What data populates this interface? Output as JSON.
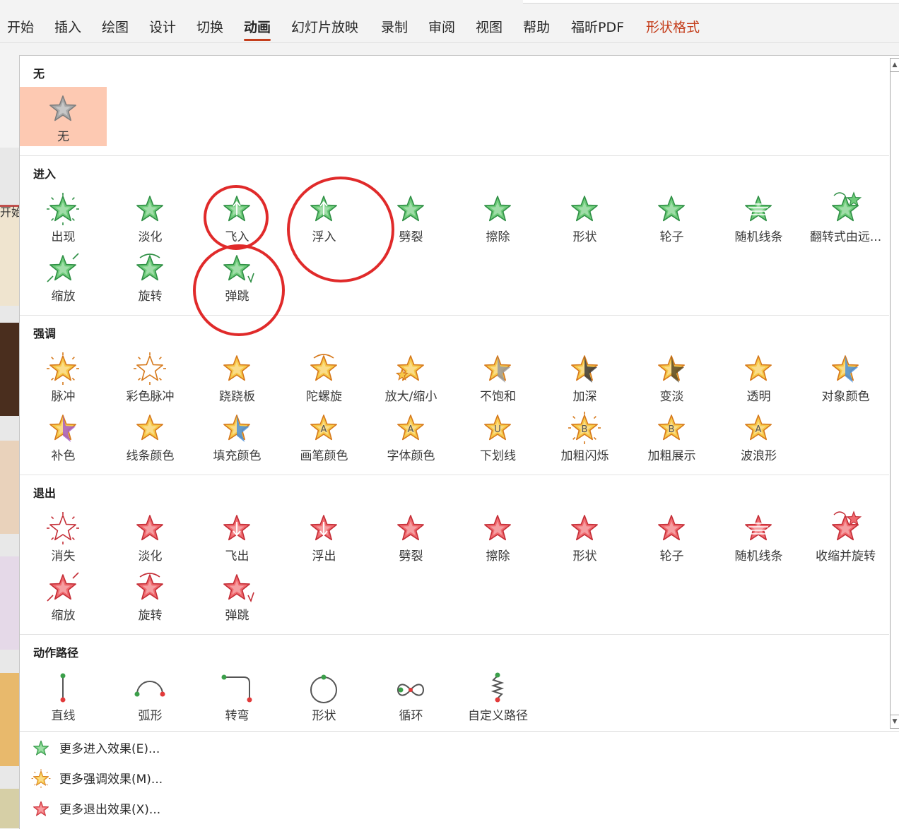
{
  "ribbon": {
    "tabs": [
      {
        "label": "开始",
        "state": "normal"
      },
      {
        "label": "插入",
        "state": "normal"
      },
      {
        "label": "绘图",
        "state": "normal"
      },
      {
        "label": "设计",
        "state": "normal"
      },
      {
        "label": "切换",
        "state": "normal"
      },
      {
        "label": "动画",
        "state": "active"
      },
      {
        "label": "幻灯片放映",
        "state": "normal"
      },
      {
        "label": "录制",
        "state": "normal"
      },
      {
        "label": "审阅",
        "state": "normal"
      },
      {
        "label": "视图",
        "state": "normal"
      },
      {
        "label": "帮助",
        "state": "normal"
      },
      {
        "label": "福昕PDF",
        "state": "normal"
      },
      {
        "label": "形状格式",
        "state": "contextual"
      }
    ]
  },
  "left_strip": {
    "partial_label": "开始"
  },
  "gallery": {
    "sections": [
      {
        "title": "无",
        "items": [
          {
            "label": "无",
            "icon": "none-star-icon",
            "kind": "none",
            "selected": true
          }
        ]
      },
      {
        "title": "进入",
        "items": [
          {
            "label": "出现",
            "icon": "appear-star-icon",
            "kind": "entrance"
          },
          {
            "label": "淡化",
            "icon": "fade-star-icon",
            "kind": "entrance"
          },
          {
            "label": "飞入",
            "icon": "fly-in-star-icon",
            "kind": "entrance",
            "highlight": true
          },
          {
            "label": "浮入",
            "icon": "float-in-star-icon",
            "kind": "entrance",
            "highlight": true
          },
          {
            "label": "劈裂",
            "icon": "split-star-icon",
            "kind": "entrance"
          },
          {
            "label": "擦除",
            "icon": "wipe-star-icon",
            "kind": "entrance"
          },
          {
            "label": "形状",
            "icon": "shape-star-icon",
            "kind": "entrance"
          },
          {
            "label": "轮子",
            "icon": "wheel-star-icon",
            "kind": "entrance"
          },
          {
            "label": "随机线条",
            "icon": "random-bars-star-icon",
            "kind": "entrance"
          },
          {
            "label": "翻转式由远...",
            "icon": "grow-turn-star-icon",
            "kind": "entrance"
          },
          {
            "label": "缩放",
            "icon": "zoom-star-icon",
            "kind": "entrance"
          },
          {
            "label": "旋转",
            "icon": "swivel-star-icon",
            "kind": "entrance"
          },
          {
            "label": "弹跳",
            "icon": "bounce-star-icon",
            "kind": "entrance",
            "highlight": true
          }
        ]
      },
      {
        "title": "强调",
        "items": [
          {
            "label": "脉冲",
            "icon": "pulse-star-icon",
            "kind": "emphasis"
          },
          {
            "label": "彩色脉冲",
            "icon": "color-pulse-star-icon",
            "kind": "emphasis"
          },
          {
            "label": "跷跷板",
            "icon": "teeter-star-icon",
            "kind": "emphasis"
          },
          {
            "label": "陀螺旋",
            "icon": "spin-star-icon",
            "kind": "emphasis"
          },
          {
            "label": "放大/缩小",
            "icon": "grow-shrink-star-icon",
            "kind": "emphasis"
          },
          {
            "label": "不饱和",
            "icon": "desaturate-star-icon",
            "kind": "emphasis"
          },
          {
            "label": "加深",
            "icon": "darken-star-icon",
            "kind": "emphasis"
          },
          {
            "label": "变淡",
            "icon": "lighten-star-icon",
            "kind": "emphasis"
          },
          {
            "label": "透明",
            "icon": "transparency-star-icon",
            "kind": "emphasis"
          },
          {
            "label": "对象颜色",
            "icon": "object-color-star-icon",
            "kind": "emphasis"
          },
          {
            "label": "补色",
            "icon": "complementary-color-star-icon",
            "kind": "emphasis"
          },
          {
            "label": "线条颜色",
            "icon": "line-color-star-icon",
            "kind": "emphasis"
          },
          {
            "label": "填充颜色",
            "icon": "fill-color-star-icon",
            "kind": "emphasis"
          },
          {
            "label": "画笔颜色",
            "icon": "brush-color-star-icon",
            "kind": "emphasis",
            "letter": "A"
          },
          {
            "label": "字体颜色",
            "icon": "font-color-star-icon",
            "kind": "emphasis",
            "letter": "A"
          },
          {
            "label": "下划线",
            "icon": "underline-star-icon",
            "kind": "emphasis",
            "letter": "U"
          },
          {
            "label": "加粗闪烁",
            "icon": "bold-flash-star-icon",
            "kind": "emphasis",
            "letter": "B"
          },
          {
            "label": "加粗展示",
            "icon": "bold-reveal-star-icon",
            "kind": "emphasis",
            "letter": "B"
          },
          {
            "label": "波浪形",
            "icon": "wave-star-icon",
            "kind": "emphasis",
            "letter": "A"
          }
        ]
      },
      {
        "title": "退出",
        "items": [
          {
            "label": "消失",
            "icon": "disappear-star-icon",
            "kind": "exit"
          },
          {
            "label": "淡化",
            "icon": "fade-out-star-icon",
            "kind": "exit"
          },
          {
            "label": "飞出",
            "icon": "fly-out-star-icon",
            "kind": "exit"
          },
          {
            "label": "浮出",
            "icon": "float-out-star-icon",
            "kind": "exit"
          },
          {
            "label": "劈裂",
            "icon": "split-out-star-icon",
            "kind": "exit"
          },
          {
            "label": "擦除",
            "icon": "wipe-out-star-icon",
            "kind": "exit"
          },
          {
            "label": "形状",
            "icon": "shape-out-star-icon",
            "kind": "exit"
          },
          {
            "label": "轮子",
            "icon": "wheel-out-star-icon",
            "kind": "exit"
          },
          {
            "label": "随机线条",
            "icon": "random-bars-out-star-icon",
            "kind": "exit"
          },
          {
            "label": "收缩并旋转",
            "icon": "shrink-turn-star-icon",
            "kind": "exit"
          },
          {
            "label": "缩放",
            "icon": "zoom-out-star-icon",
            "kind": "exit"
          },
          {
            "label": "旋转",
            "icon": "swivel-out-star-icon",
            "kind": "exit"
          },
          {
            "label": "弹跳",
            "icon": "bounce-out-star-icon",
            "kind": "exit"
          }
        ]
      },
      {
        "title": "动作路径",
        "items": [
          {
            "label": "直线",
            "icon": "line-path-icon",
            "kind": "path"
          },
          {
            "label": "弧形",
            "icon": "arc-path-icon",
            "kind": "path"
          },
          {
            "label": "转弯",
            "icon": "turn-path-icon",
            "kind": "path"
          },
          {
            "label": "形状",
            "icon": "shape-path-icon",
            "kind": "path"
          },
          {
            "label": "循环",
            "icon": "loop-path-icon",
            "kind": "path"
          },
          {
            "label": "自定义路径",
            "icon": "custom-path-icon",
            "kind": "path"
          }
        ]
      }
    ]
  },
  "more_effects": [
    {
      "label": "更多进入效果(E)...",
      "icon": "more-entrance-star-icon",
      "kind": "entrance"
    },
    {
      "label": "更多强调效果(M)...",
      "icon": "more-emphasis-star-icon",
      "kind": "emphasis"
    },
    {
      "label": "更多退出效果(X)...",
      "icon": "more-exit-star-icon",
      "kind": "exit"
    }
  ],
  "colors": {
    "accent": "#c43e1c",
    "selection": "#fdc9b2",
    "entrance_fill": "#6ecb7a",
    "entrance_stroke": "#2f8f45",
    "emphasis_fill": "#f7c94a",
    "emphasis_stroke": "#d6791c",
    "exit_fill": "#f06a6f",
    "exit_stroke": "#c42d36",
    "none_fill": "#a9a9a9",
    "annotation_ring": "#e02a2a"
  }
}
